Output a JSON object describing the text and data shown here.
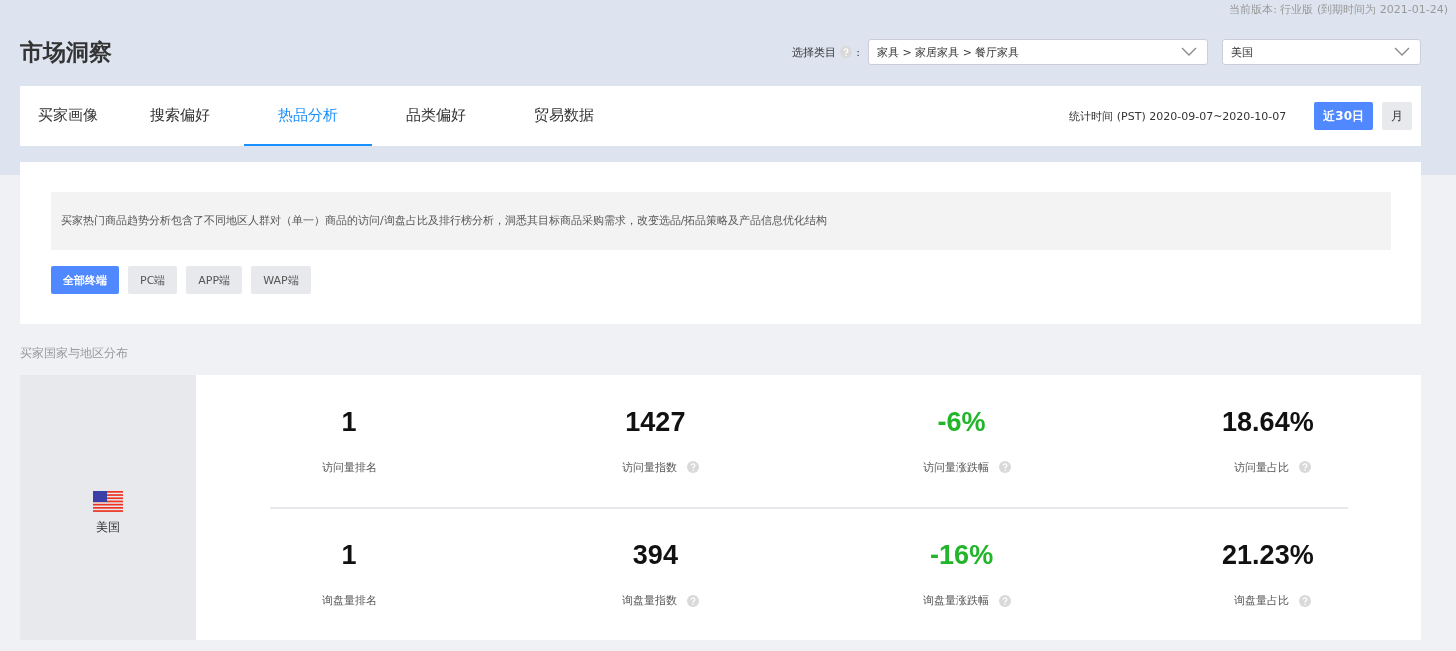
{
  "version_notice": "当前版本: 行业版 (到期时间为 2021-01-24)",
  "title": "市场洞察",
  "category_selector": {
    "label": "选择类目",
    "help": true,
    "separator": ":",
    "value": "家具 > 家居家具 > 餐厅家具"
  },
  "country_selector": {
    "value": "美国"
  },
  "tabs": [
    {
      "label": "买家画像",
      "selected": false
    },
    {
      "label": "搜索偏好",
      "selected": false
    },
    {
      "label": "热品分析",
      "selected": true
    },
    {
      "label": "品类偏好",
      "selected": false
    },
    {
      "label": "贸易数据",
      "selected": false
    }
  ],
  "stat_period": "统计时间 (PST) 2020-09-07~2020-10-07",
  "period_buttons": [
    {
      "label": "近30日",
      "selected": true
    },
    {
      "label": "月",
      "selected": false
    }
  ],
  "description": "买家热门商品趋势分析包含了不同地区人群对（单一）商品的访问/询盘占比及排行榜分析，洞悉其目标商品采购需求，改变选品/拓品策略及产品信息优化结构",
  "terminal_filters": [
    {
      "label": "全部终端",
      "selected": true
    },
    {
      "label": "PC端",
      "selected": false
    },
    {
      "label": "APP端",
      "selected": false
    },
    {
      "label": "WAP端",
      "selected": false
    }
  ],
  "section_title": "买家国家与地区分布",
  "region": {
    "name": "美国"
  },
  "metric_rows": [
    {
      "metrics": [
        {
          "value": "1",
          "label": "访问量排名",
          "help": false,
          "color": "#111111"
        },
        {
          "value": "1427",
          "label": "访问量指数",
          "help": true,
          "color": "#111111"
        },
        {
          "value": "-6%",
          "label": "访问量涨跌幅",
          "help": true,
          "color": "#22b52a"
        },
        {
          "value": "18.64%",
          "label": "访问量占比",
          "help": true,
          "color": "#111111"
        }
      ]
    },
    {
      "metrics": [
        {
          "value": "1",
          "label": "询盘量排名",
          "help": false,
          "color": "#111111"
        },
        {
          "value": "394",
          "label": "询盘量指数",
          "help": true,
          "color": "#111111"
        },
        {
          "value": "-16%",
          "label": "询盘量涨跌幅",
          "help": true,
          "color": "#22b52a"
        },
        {
          "value": "21.23%",
          "label": "询盘量占比",
          "help": true,
          "color": "#111111"
        }
      ]
    }
  ]
}
